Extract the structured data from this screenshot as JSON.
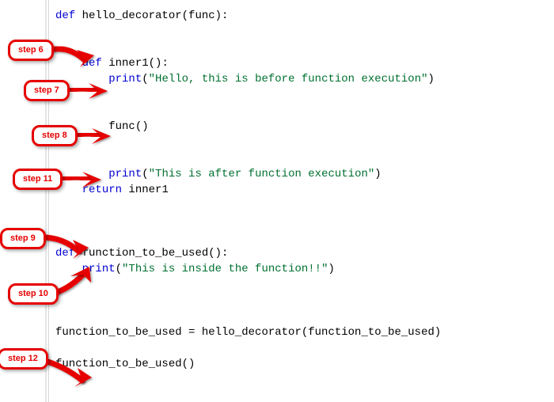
{
  "code": {
    "kw_def1": "def",
    "fn_hello": " hello_decorator(func):",
    "blank1": "",
    "blank2": "",
    "indent4": "    ",
    "kw_def2": "def",
    "fn_inner": " inner1():",
    "indent8": "        ",
    "kw_print1": "print",
    "open_paren": "(",
    "str1": "\"Hello, this is before function execution\"",
    "close_paren": ")",
    "func_call": "func()",
    "kw_print2": "print",
    "str2": "\"This is after function execution\"",
    "kw_return": "return",
    "ret_val": " inner1",
    "kw_def3": "def",
    "fn_ftbu": " function_to_be_used():",
    "kw_print3": "print",
    "str3": "\"This is inside the function!!\"",
    "assign_line": "function_to_be_used = hello_decorator(function_to_be_used)",
    "call_line": "function_to_be_used()"
  },
  "callouts": {
    "s6": "step 6",
    "s7": "step 7",
    "s8": "step 8",
    "s11": "step 11",
    "s9": "step 9",
    "s10": "step 10",
    "s12": "step 12"
  },
  "arrow_color": "#e60000"
}
